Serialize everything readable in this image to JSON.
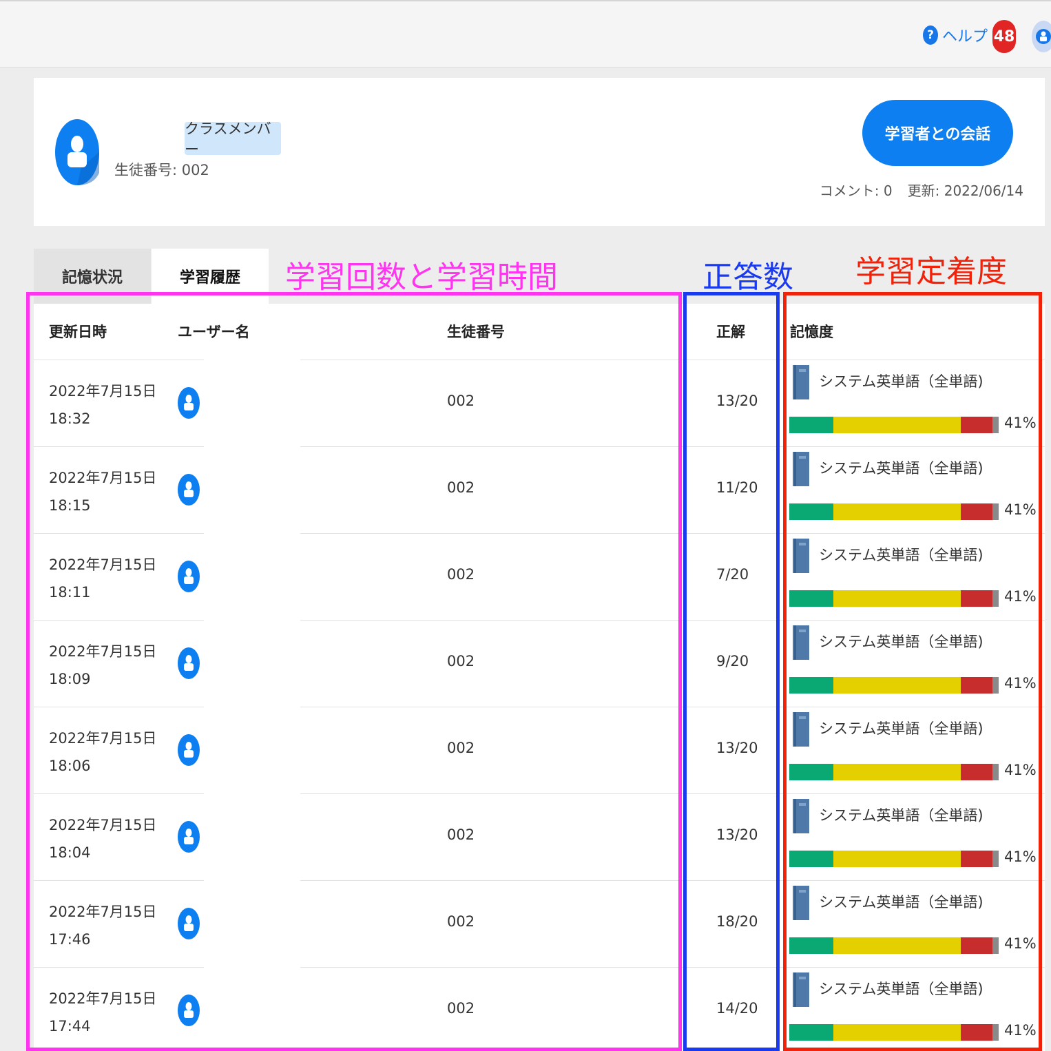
{
  "header": {
    "help_label": "ヘルプ",
    "help_icon_glyph": "?",
    "notification_count": "48"
  },
  "profile": {
    "member_tag": "クラスメンバー",
    "student_number_text": "生徒番号: 002",
    "chat_button_label": "学習者との会話",
    "comments_text": "コメント: 0",
    "updated_text": "更新: 2022/06/14"
  },
  "tabs": [
    {
      "label": "記憶状況",
      "active": false
    },
    {
      "label": "学習履歴",
      "active": true
    }
  ],
  "table": {
    "headers": {
      "updated_at": "更新日時",
      "username": "ユーザー名",
      "student_number": "生徒番号",
      "correct": "正解",
      "retention": "記憶度"
    },
    "rows": [
      {
        "date": "2022年7月15日",
        "time": "18:32",
        "student_number": "002",
        "score": "13/20",
        "course": "システム英単語（全単語)",
        "percent": "41%",
        "segments": [
          0.21,
          0.61,
          0.15,
          0.03
        ]
      },
      {
        "date": "2022年7月15日",
        "time": "18:15",
        "student_number": "002",
        "score": "11/20",
        "course": "システム英単語（全単語)",
        "percent": "41%",
        "segments": [
          0.21,
          0.61,
          0.15,
          0.03
        ]
      },
      {
        "date": "2022年7月15日",
        "time": "18:11",
        "student_number": "002",
        "score": "7/20",
        "course": "システム英単語（全単語)",
        "percent": "41%",
        "segments": [
          0.21,
          0.61,
          0.15,
          0.03
        ]
      },
      {
        "date": "2022年7月15日",
        "time": "18:09",
        "student_number": "002",
        "score": "9/20",
        "course": "システム英単語（全単語)",
        "percent": "41%",
        "segments": [
          0.21,
          0.61,
          0.15,
          0.03
        ]
      },
      {
        "date": "2022年7月15日",
        "time": "18:06",
        "student_number": "002",
        "score": "13/20",
        "course": "システム英単語（全単語)",
        "percent": "41%",
        "segments": [
          0.21,
          0.61,
          0.15,
          0.03
        ]
      },
      {
        "date": "2022年7月15日",
        "time": "18:04",
        "student_number": "002",
        "score": "13/20",
        "course": "システム英単語（全単語)",
        "percent": "41%",
        "segments": [
          0.21,
          0.61,
          0.15,
          0.03
        ]
      },
      {
        "date": "2022年7月15日",
        "time": "17:46",
        "student_number": "002",
        "score": "18/20",
        "course": "システム英単語（全単語)",
        "percent": "41%",
        "segments": [
          0.21,
          0.61,
          0.15,
          0.03
        ]
      },
      {
        "date": "2022年7月15日",
        "time": "17:44",
        "student_number": "002",
        "score": "14/20",
        "course": "システム英単語（全単語)",
        "percent": "41%",
        "segments": [
          0.21,
          0.61,
          0.15,
          0.03
        ]
      }
    ]
  },
  "annotations": {
    "count_time": "学習回数と学習時間",
    "correct_count": "正答数",
    "retention_level": "学習定着度"
  },
  "colors": {
    "accent": "#0d7ff0",
    "badge": "#e12525",
    "bar_green": "#0aa873",
    "bar_yellow": "#e4d000",
    "bar_red": "#c82d2d",
    "bar_gray": "#8a8a8a",
    "annotation_magenta": "#ff33f0",
    "annotation_blue": "#1a3af0",
    "annotation_red": "#f0220a"
  },
  "icons": {
    "help": "question-circle-icon",
    "avatar": "user-avatar-icon",
    "book": "book-icon"
  }
}
